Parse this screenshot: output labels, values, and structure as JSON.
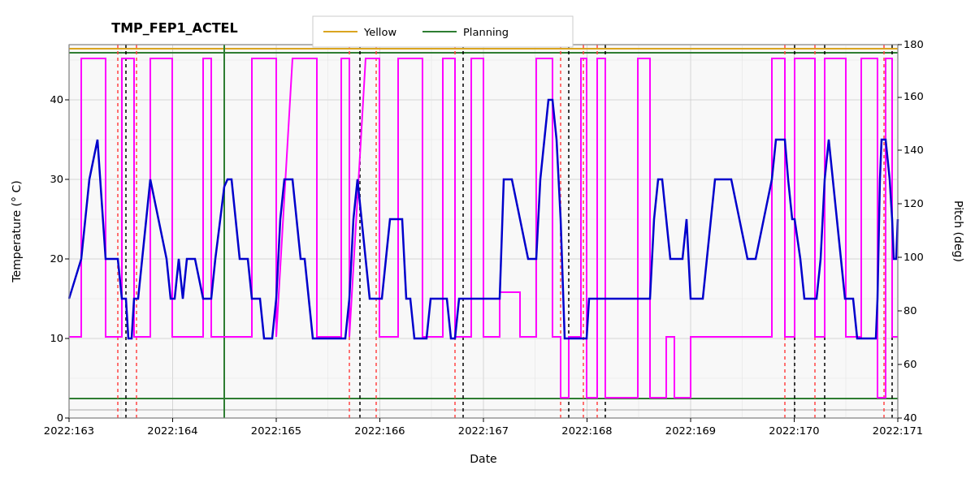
{
  "chart": {
    "title": "TMP_FEP1_ACTEL",
    "x_axis_label": "Date",
    "y_left_label": "Temperature (° C)",
    "y_right_label": "Pitch (deg)",
    "legend": {
      "yellow_label": "Yellow",
      "planning_label": "Planning"
    },
    "x_ticks": [
      "2022:163",
      "2022:164",
      "2022:165",
      "2022:166",
      "2022:167",
      "2022:168",
      "2022:169",
      "2022:170",
      "2022:171"
    ],
    "y_left_ticks": [
      "0",
      "10",
      "20",
      "30",
      "40"
    ],
    "y_right_ticks": [
      "40",
      "60",
      "80",
      "100",
      "120",
      "140",
      "160",
      "180"
    ],
    "yellow_line_value": 46.5,
    "planning_min_value": 2.5,
    "planning_max_value": 46.0,
    "colors": {
      "yellow_line": "#DAA520",
      "planning_line": "#2E7D32",
      "blue_line": "#0000CC",
      "magenta_line": "#FF00FF",
      "red_dashed": "#FF4444",
      "black_dashed": "#000000",
      "grid": "#cccccc",
      "background": "#f8f8f8"
    }
  }
}
